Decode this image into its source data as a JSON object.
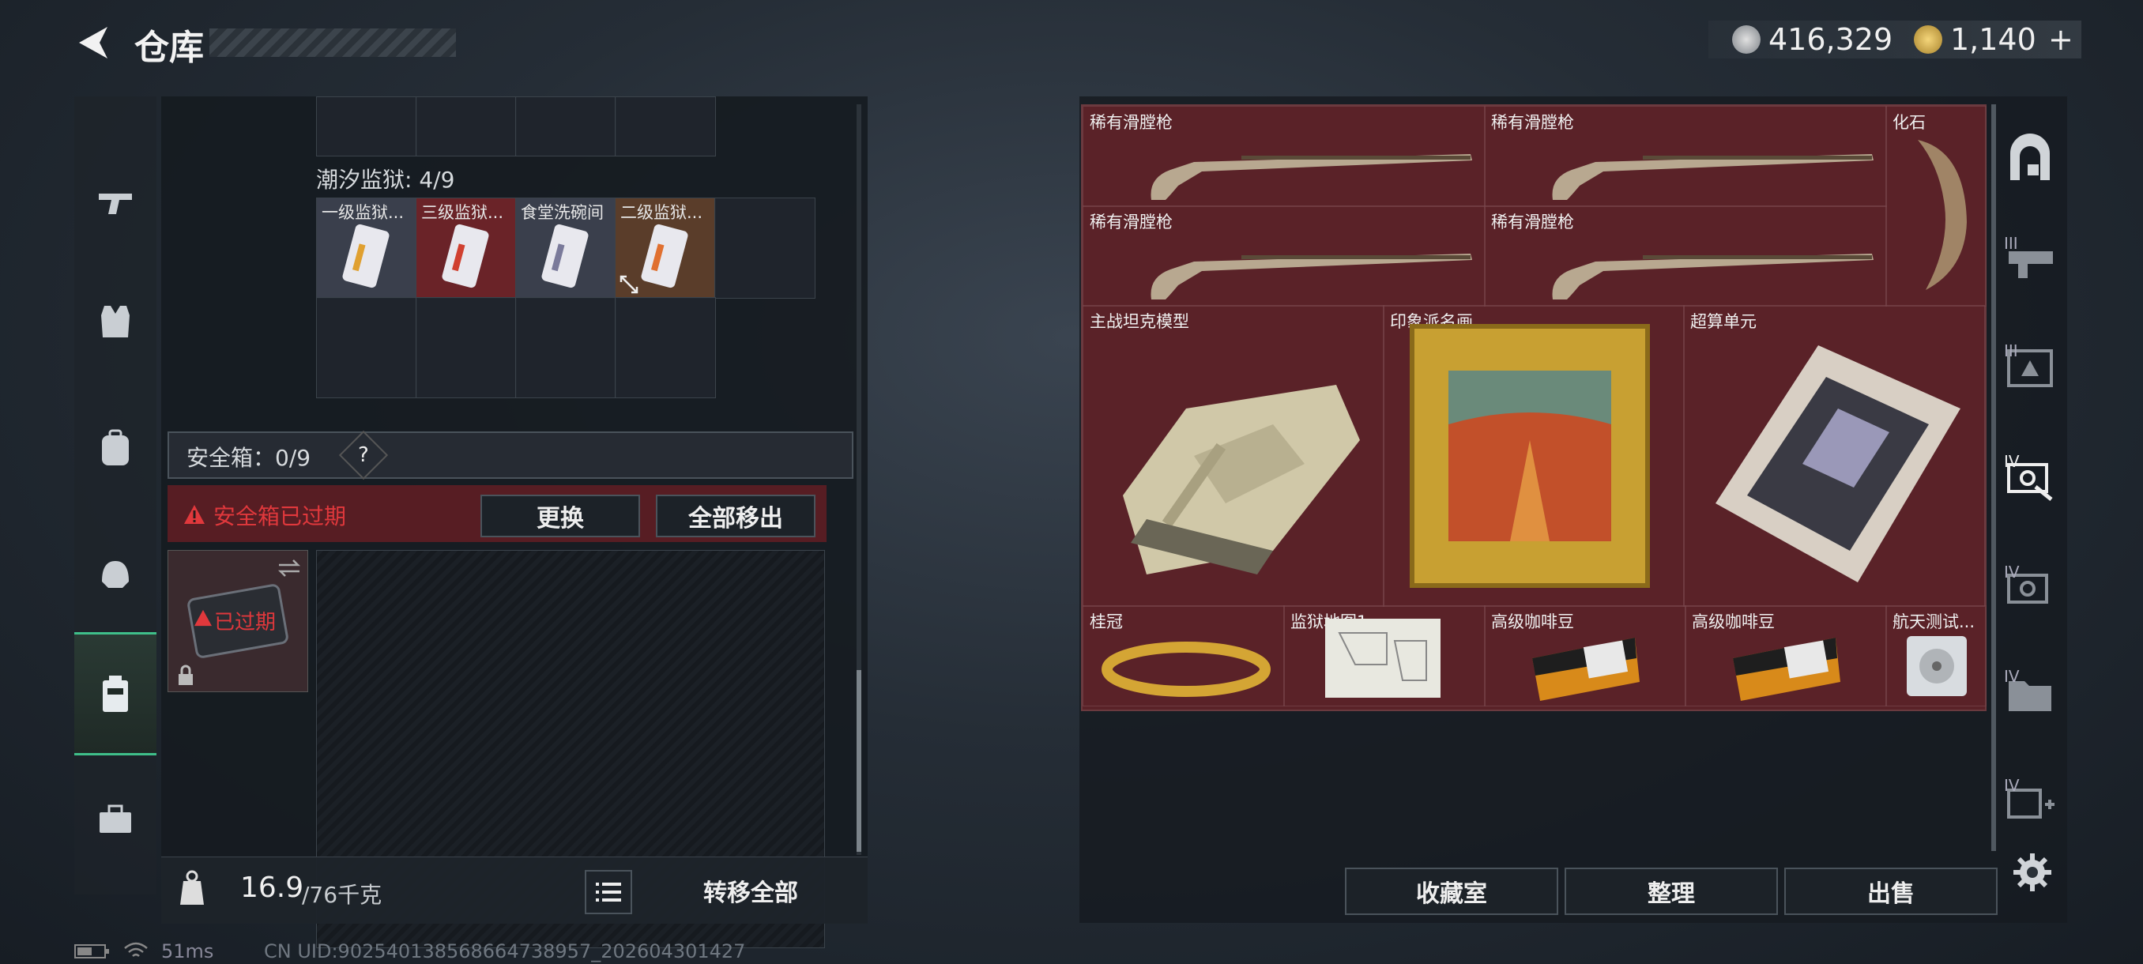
{
  "header": {
    "title": "仓库",
    "currency_silver": "416,329",
    "currency_gold": "1,140",
    "add_label": "+"
  },
  "colors": {
    "accent": "#3fbf8a",
    "danger": "#e0383c",
    "grid_bg": "#5a2228"
  },
  "left_nav": {
    "items": [
      "gun-icon",
      "vest-icon",
      "backpack-icon",
      "helmet-icon",
      "safebox-icon",
      "toolbox-icon"
    ],
    "active": 4
  },
  "prison": {
    "title": "潮汐监狱: 4/9",
    "items": [
      {
        "label": "一级监狱..."
      },
      {
        "label": "三级监狱..."
      },
      {
        "label": "食堂洗碗间"
      },
      {
        "label": "二级监狱..."
      }
    ]
  },
  "safebox": {
    "title": "安全箱：0/9",
    "help": "?",
    "expired_msg": "安全箱已过期",
    "replace_label": "更换",
    "move_all_label": "全部移出",
    "expired_tag": "已过期"
  },
  "footer": {
    "weight": "16.9",
    "weight_max": "/76千克",
    "transfer_label": "转移全部"
  },
  "status": {
    "ping": "51ms",
    "uid": "CN UID:902540138568664738957_202604301427"
  },
  "stash": {
    "items": [
      {
        "label": "稀有滑膛枪"
      },
      {
        "label": "稀有滑膛枪"
      },
      {
        "label": "化石"
      },
      {
        "label": "稀有滑膛枪"
      },
      {
        "label": "稀有滑膛枪"
      },
      {
        "label": "主战坦克模型"
      },
      {
        "label": "印象派名画"
      },
      {
        "label": "超算单元"
      },
      {
        "label": "桂冠"
      },
      {
        "label": "监狱地图1"
      },
      {
        "label": "高级咖啡豆"
      },
      {
        "label": "高级咖啡豆"
      },
      {
        "label": "航天测试..."
      }
    ]
  },
  "bottom_buttons": {
    "collection": "收藏室",
    "sort": "整理",
    "sell": "出售"
  },
  "right_nav": {
    "tags": [
      "III",
      "III",
      "IV",
      "IV",
      "IV",
      "IV"
    ]
  }
}
